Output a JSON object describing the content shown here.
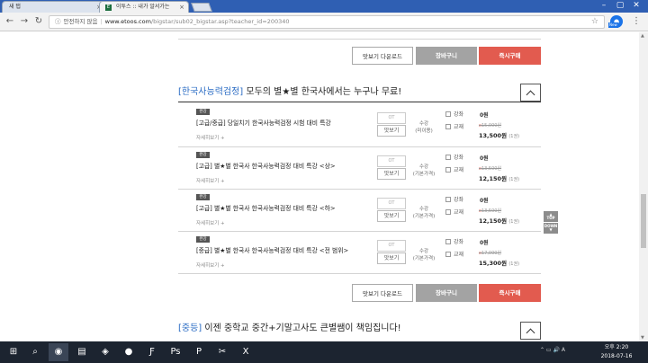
{
  "browser": {
    "tabs": [
      {
        "title": "새 탭"
      },
      {
        "title": "이투스 :: 내가 알서가는",
        "favicon": "E"
      }
    ],
    "address": {
      "security_label": "안전하지 않음",
      "host": "www.etoos.com",
      "path": "/bigstar/sub02_bigstar.asp?teacher_id=200340"
    },
    "extension_badge": "New"
  },
  "buttons": {
    "sample_download": "맛보기 다운로드",
    "cart": "장바구니",
    "buy_now": "즉시구매"
  },
  "section_korean_history": {
    "tag": "[한국사능력검정]",
    "title": " 모두의 별★별 한국사에서는 누구나 무료!"
  },
  "courses": [
    {
      "badge": "완강",
      "title": "[고급/중급] 당일치기 한국사능력검정 시험 대비 특강",
      "detail": "자세히보기",
      "ot": "OT",
      "preview": "맛보기",
      "mode_line1": "수강",
      "mode_line2": "(미이용)",
      "option1": "강좌",
      "option2": "교재",
      "price_course": "0원",
      "old_price": "15,000원",
      "new_price": "13,500원",
      "volume": "(1권)"
    },
    {
      "badge": "완강",
      "title": "[고급] 별★별 한국사 한국사능력검정 대비 특강 <상>",
      "detail": "자세히보기",
      "ot": "OT",
      "preview": "맛보기",
      "mode_line1": "수강",
      "mode_line2": "(기본가격)",
      "option1": "강좌",
      "option2": "교재",
      "price_course": "0원",
      "old_price": "13,500원",
      "new_price": "12,150원",
      "volume": "(1권)"
    },
    {
      "badge": "완강",
      "title": "[고급] 별★별 한국사 한국사능력검정 대비 특강 <하>",
      "detail": "자세히보기",
      "ot": "OT",
      "preview": "맛보기",
      "mode_line1": "수강",
      "mode_line2": "(기본가격)",
      "option1": "강좌",
      "option2": "교재",
      "price_course": "0원",
      "old_price": "13,500원",
      "new_price": "12,150원",
      "volume": "(1권)"
    },
    {
      "badge": "완강",
      "title": "[중급] 별★별 한국사 한국사능력검정 대비 특강 <전 범위>",
      "detail": "자세히보기",
      "ot": "OT",
      "preview": "맛보기",
      "mode_line1": "수강",
      "mode_line2": "(기본가격)",
      "option1": "강좌",
      "option2": "교재",
      "price_course": "0원",
      "old_price": "17,000원",
      "new_price": "15,300원",
      "volume": "(1권)"
    }
  ],
  "side_nav": {
    "top": "TOP",
    "down": "DOWN"
  },
  "section_middle": {
    "tag": "[중등]",
    "title": " 이젠 중학교 중간+기말고사도 큰별쌤이 책임집니다!"
  },
  "taskbar": {
    "time_line1": "오후 2:20",
    "time_line2": "2018-07-16"
  },
  "colors": {
    "accent_blue": "#2b6cc4",
    "buy_red": "#e25b4f",
    "cart_gray": "#a3a3a3"
  }
}
